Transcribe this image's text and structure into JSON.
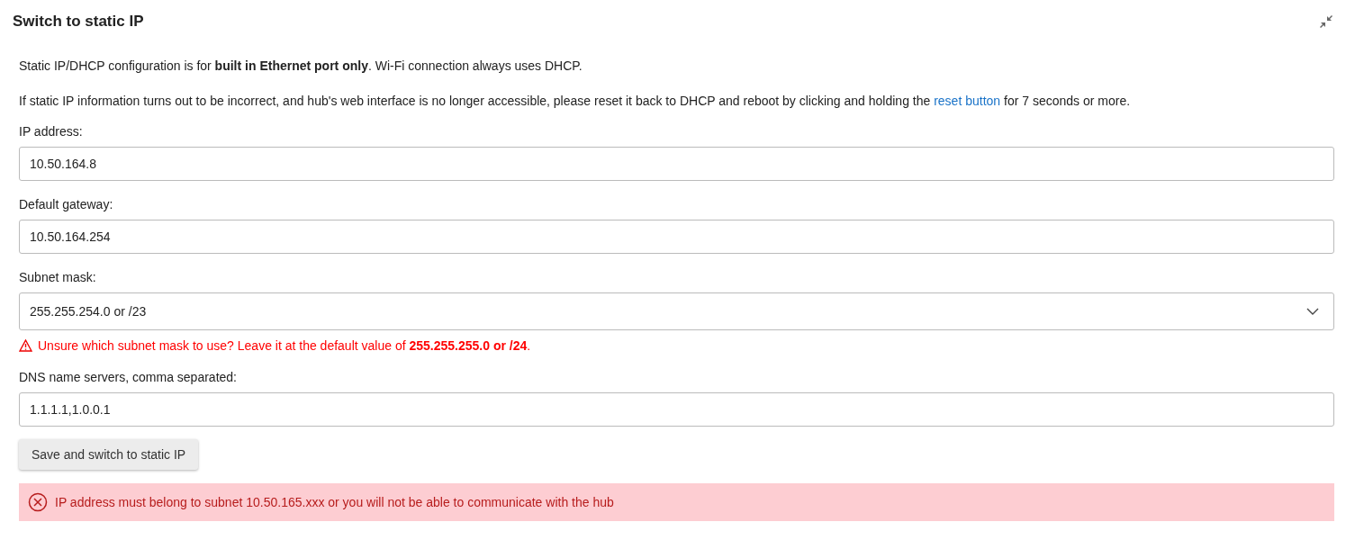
{
  "title": "Switch to static IP",
  "intro": "Static IP/DHCP configuration is for **built in Ethernet port only**. Wi-Fi connection always uses DHCP.",
  "reset_note": {
    "before": "If static IP information turns out to be incorrect, and hub's web interface is no longer accessible, please reset it back to DHCP and reboot by clicking and holding the",
    "link": "reset button",
    "after": "for 7 seconds or more."
  },
  "fields": [
    {
      "kind": "input",
      "label": "IP address:",
      "value": "10.50.164.8"
    },
    {
      "kind": "input",
      "label": "Default gateway:",
      "value": "10.50.164.254"
    },
    {
      "kind": "select",
      "label": "Subnet mask:",
      "value": "255.255.254.0 or /23",
      "warning": "Unsure which subnet mask to use? Leave it at the default value of **255.255.255.0 or /24**."
    },
    {
      "kind": "input",
      "label": "DNS name servers, comma separated:",
      "value": "1.1.1.1,1.0.0.1"
    }
  ],
  "save_button": "Save and switch to static IP",
  "error": "IP address must belong to subnet 10.50.165.xxx or you will not be able to communicate with the hub"
}
